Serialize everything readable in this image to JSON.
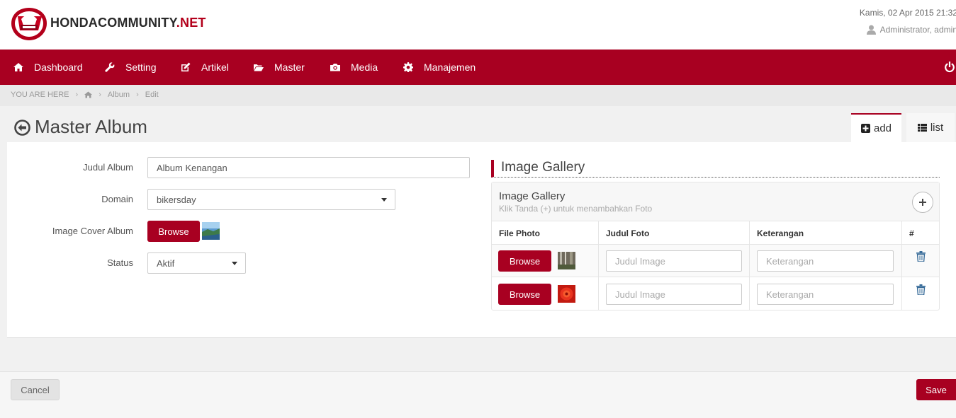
{
  "header": {
    "brand_main": "HONDACOMMUNITY",
    "brand_suffix": ".NET",
    "date": "Kamis, 02 Apr 2015 21:32",
    "user": "Administrator, admin"
  },
  "nav": {
    "items": [
      {
        "label": "Dashboard",
        "icon": "home-icon"
      },
      {
        "label": "Setting",
        "icon": "wrench-icon"
      },
      {
        "label": "Artikel",
        "icon": "edit-icon"
      },
      {
        "label": "Master",
        "icon": "folder-open-icon"
      },
      {
        "label": "Media",
        "icon": "camera-icon"
      },
      {
        "label": "Manajemen",
        "icon": "gear-icon"
      }
    ]
  },
  "breadcrumb": {
    "prefix": "YOU ARE HERE",
    "items": [
      "Album",
      "Edit"
    ]
  },
  "page": {
    "title": "Master Album",
    "tabs": {
      "add": "add",
      "list": "list"
    }
  },
  "form": {
    "judul_label": "Judul Album",
    "judul_value": "Album Kenangan",
    "domain_label": "Domain",
    "domain_value": "bikersday",
    "cover_label": "Image Cover Album",
    "browse_label": "Browse",
    "status_label": "Status",
    "status_value": "Aktif"
  },
  "gallery": {
    "heading": "Image Gallery",
    "box_title": "Image Gallery",
    "box_subtitle": "Klik Tanda (+) untuk menambahkan Foto",
    "columns": [
      "File Photo",
      "Judul Foto",
      "Keterangan",
      "#"
    ],
    "rows": [
      {
        "browse": "Browse",
        "judul_placeholder": "Judul Image",
        "keterangan_placeholder": "Keterangan"
      },
      {
        "browse": "Browse",
        "judul_placeholder": "Judul Image",
        "keterangan_placeholder": "Keterangan"
      }
    ]
  },
  "footer": {
    "cancel": "Cancel",
    "save": "Save"
  },
  "colors": {
    "accent": "#a80021"
  }
}
